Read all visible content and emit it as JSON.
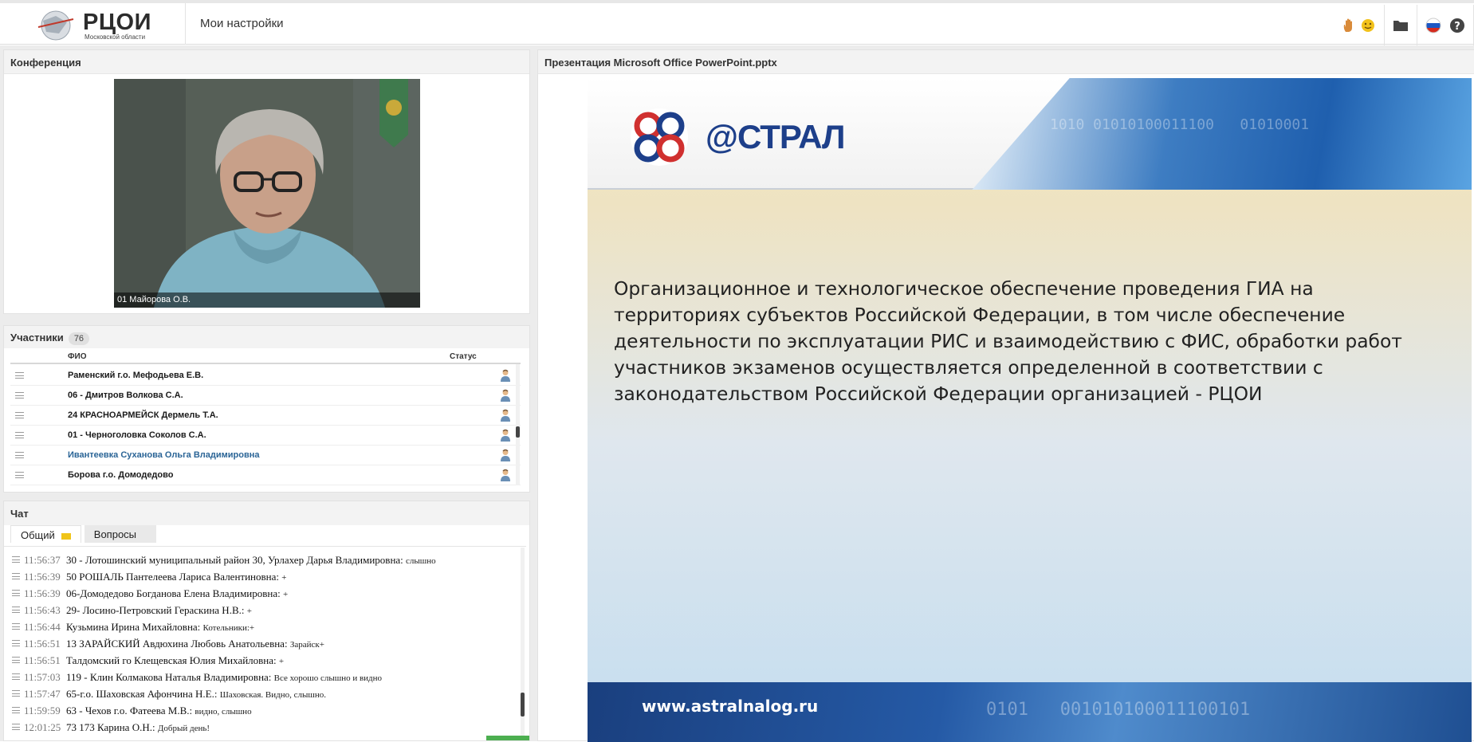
{
  "header": {
    "logo_title": "РЦОИ",
    "logo_subtitle": "Московской области",
    "page_title": "Мои настройки"
  },
  "conference": {
    "title": "Конференция",
    "video_caption": "01 Майорова О.В."
  },
  "participants": {
    "title": "Участники",
    "count": "76",
    "col_name": "ФИО",
    "col_status": "Статус",
    "rows": [
      {
        "name": "Раменский г.о. Мефодьева Е.В."
      },
      {
        "name": "06 - Дмитров Волкова С.А."
      },
      {
        "name": "24 КРАСНОАРМЕЙСК  Дермель Т.А."
      },
      {
        "name": "01 - Черноголовка Соколов С.А."
      },
      {
        "name": "Ивантеевка Суханова Ольга Владимировна"
      },
      {
        "name": "Борова г.о. Домодедово"
      }
    ]
  },
  "chat": {
    "title": "Чат",
    "tab_general": "Общий",
    "tab_questions": "Вопросы",
    "messages": [
      {
        "time": "11:56:37",
        "author": "30 - Лотошинский муниципальный район 30, Урлахер Дарья Владимировна:",
        "text": "слышно"
      },
      {
        "time": "11:56:39",
        "author": "50 РОШАЛЬ Пантелеева Лариса Валентиновна:",
        "text": "+"
      },
      {
        "time": "11:56:39",
        "author": "06-Домодедово Богданова Елена Владимировна:",
        "text": "+"
      },
      {
        "time": "11:56:43",
        "author": "29- Лосино-Петровский Гераскина Н.В.:",
        "text": "+"
      },
      {
        "time": "11:56:44",
        "author": "Кузьмина Ирина Михайловна:",
        "text": "Котельники:+"
      },
      {
        "time": "11:56:51",
        "author": "13 ЗАРАЙСКИЙ Авдюхина Любовь Анатольевна:",
        "text": "Зарайск+"
      },
      {
        "time": "11:56:51",
        "author": "Талдомский го Клещевская Юлия Михайловна:",
        "text": "+"
      },
      {
        "time": "11:57:03",
        "author": "119 - Клин Колмакова Наталья Владимировна:",
        "text": "Все хорошо слышно и видно"
      },
      {
        "time": "11:57:47",
        "author": "65-г.о. Шаховская Афончина Н.Е.:",
        "text": "Шаховская. Видно, слышно."
      },
      {
        "time": "11:59:59",
        "author": "63 - Чехов г.о. Фатеева М.В.:",
        "text": "видно, слышно"
      },
      {
        "time": "12:01:25",
        "author": "73 173 Карина О.Н.:",
        "text": "Добрый день!"
      }
    ]
  },
  "presentation": {
    "title": "Презентация Microsoft Office PowerPoint.pptx",
    "brand": "@СТРАЛ",
    "body": "Организационное и технологическое обеспечение  проведения ГИА на территориях субъектов Российской Федерации, в том числе обеспечение  деятельности по эксплуатации РИС и взаимодействию с ФИС, обработки работ участников экзаменов осуществляется определенной в соответствии с законодательством Российской Федерации организацией - РЦОИ",
    "url": "www.astralnalog.ru"
  },
  "colors": {
    "link": "#2a6496",
    "accent_green": "#4caf50",
    "slide_blue": "#1f5fae"
  },
  "icons": [
    "raise-hand-icon",
    "emoji-icon",
    "folder-icon",
    "russian-flag-icon",
    "help-icon",
    "hamburger-menu-icon",
    "user-avatar-icon"
  ]
}
